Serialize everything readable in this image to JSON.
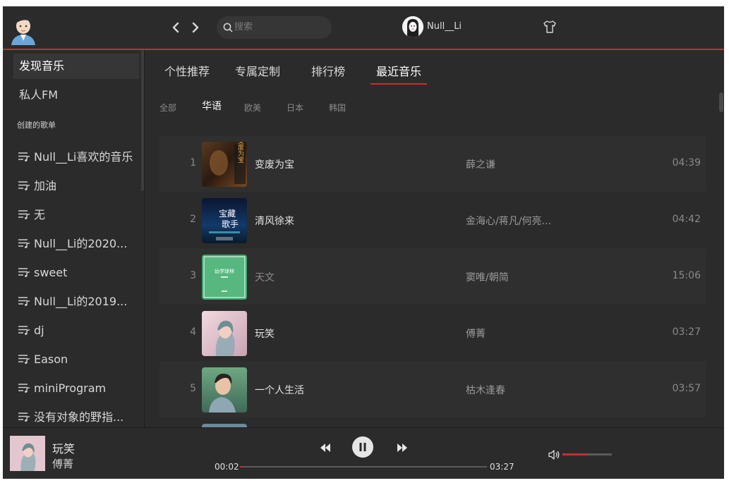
{
  "header": {
    "search_placeholder": "搜索",
    "username": "Null__Li"
  },
  "sidebar": {
    "nav": [
      {
        "label": "发现音乐",
        "active": true
      },
      {
        "label": "私人FM",
        "active": false
      }
    ],
    "section_title": "创建的歌单",
    "playlists": [
      "Null__Li喜欢的音乐",
      "加油",
      "无",
      "Null__Li的2020...",
      "sweet",
      "Null__Li的2019...",
      "dj",
      "Eason",
      "miniProgram",
      "没有对象的野指..."
    ]
  },
  "main": {
    "tabs": [
      "个性推荐",
      "专属定制",
      "排行榜",
      "最近音乐"
    ],
    "active_tab": "最近音乐",
    "filters": [
      "全部",
      "华语",
      "欧美",
      "日本",
      "韩国"
    ],
    "active_filter": "华语",
    "songs": [
      {
        "index": "1",
        "title": "变废为宝",
        "artist": "薛之谦",
        "duration": "04:39"
      },
      {
        "index": "2",
        "title": "清风徐来",
        "artist": "金海心/蒋凡/何亮...",
        "duration": "04:42"
      },
      {
        "index": "3",
        "title": "天文",
        "artist": "窦唯/朝简",
        "duration": "15:06"
      },
      {
        "index": "4",
        "title": "玩笑",
        "artist": "傅菁",
        "duration": "03:27"
      },
      {
        "index": "5",
        "title": "一个人生活",
        "artist": "枯木逢春",
        "duration": "03:57"
      }
    ],
    "cover_text": {
      "song1": "变废为宝",
      "song2_line1": "宝藏",
      "song2_line2": "歌手",
      "song3": "幼学琼林"
    }
  },
  "player": {
    "title": "玩笑",
    "artist": "傅菁",
    "current_time": "00:02",
    "total_time": "03:27",
    "progress_percent": 1,
    "volume_percent": 52,
    "state": "playing"
  },
  "colors": {
    "accent": "#c62f2f",
    "background": "#2b2b2b"
  },
  "icons": [
    "back-arrow-icon",
    "forward-arrow-icon",
    "search-icon",
    "skin-icon",
    "playlist-icon",
    "prev-icon",
    "pause-icon",
    "next-icon",
    "volume-icon"
  ]
}
